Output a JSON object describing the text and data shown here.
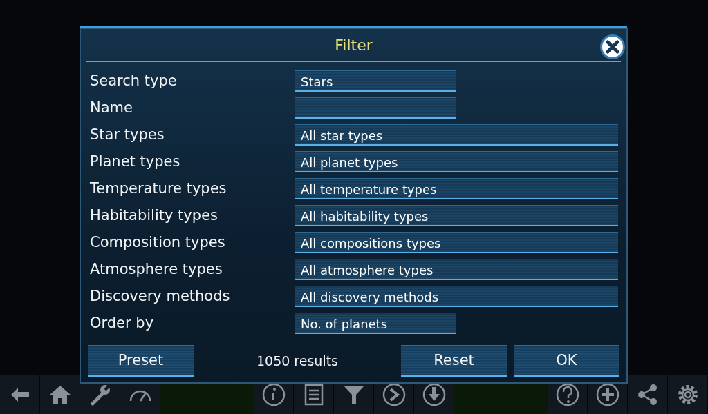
{
  "dialog": {
    "title": "Filter",
    "rows": [
      {
        "label": "Search type",
        "kind": "choice",
        "value": "Stars"
      },
      {
        "label": "Name",
        "kind": "text",
        "value": ""
      },
      {
        "label": "Star types",
        "kind": "multi",
        "value": "All star types"
      },
      {
        "label": "Planet types",
        "kind": "multi",
        "value": "All planet types"
      },
      {
        "label": "Temperature types",
        "kind": "multi",
        "value": "All temperature types"
      },
      {
        "label": "Habitability types",
        "kind": "multi",
        "value": "All habitability types"
      },
      {
        "label": "Composition types",
        "kind": "multi",
        "value": "All compositions types"
      },
      {
        "label": "Atmosphere types",
        "kind": "multi",
        "value": "All atmosphere types"
      },
      {
        "label": "Discovery methods",
        "kind": "multi",
        "value": "All discovery methods"
      },
      {
        "label": "Order by",
        "kind": "choice",
        "value": "No. of planets"
      }
    ],
    "preset_button": "Preset",
    "results": "1050 results",
    "reset_button": "Reset",
    "ok_button": "OK"
  }
}
